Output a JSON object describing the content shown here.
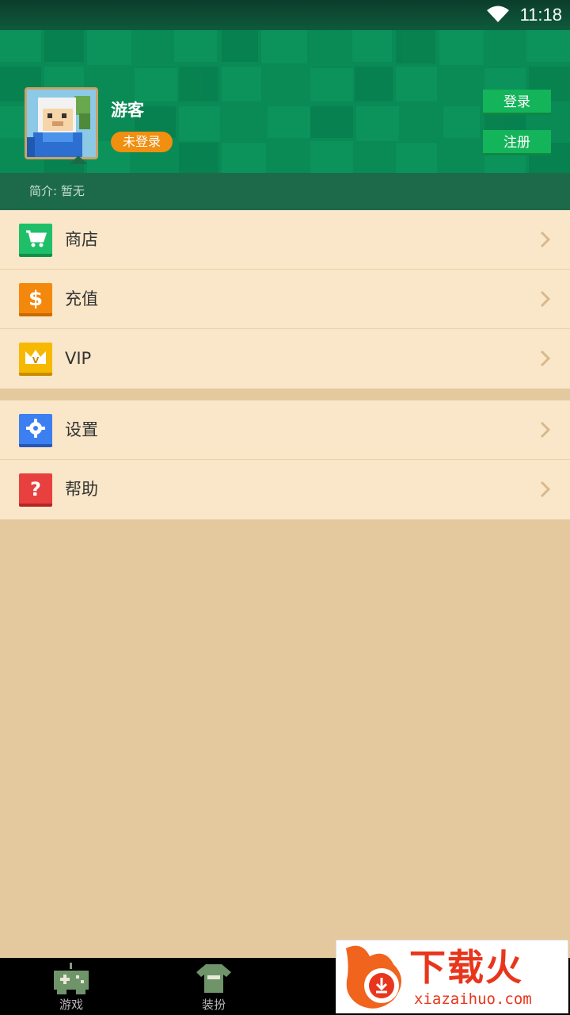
{
  "status_bar": {
    "time": "11:18",
    "wifi_icon": "wifi-icon"
  },
  "profile": {
    "name": "游客",
    "login_status": "未登录",
    "login_button": "登录",
    "register_button": "注册",
    "bio": "简介: 暂无",
    "avatar_icon": "avatar-blocky-character"
  },
  "menu_group_1": [
    {
      "label": "商店",
      "icon": "cart-icon",
      "color": "#1fbf6a"
    },
    {
      "label": "充值",
      "icon": "dollar-icon",
      "color": "#f4880c"
    },
    {
      "label": "VIP",
      "icon": "crown-icon",
      "color": "#f7b900"
    }
  ],
  "menu_group_2": [
    {
      "label": "设置",
      "icon": "gear-icon",
      "color": "#3b7ff0"
    },
    {
      "label": "帮助",
      "icon": "question-icon",
      "color": "#e8403f"
    }
  ],
  "bottom_nav": [
    {
      "label": "游戏",
      "icon": "gamepad-icon"
    },
    {
      "label": "装扮",
      "icon": "shirt-icon"
    }
  ],
  "watermark": {
    "title": "下载火",
    "url": "xiazaihuo.com"
  },
  "colors": {
    "header_green": "#0a8a55",
    "bio_bar": "#1d6a4a",
    "menu_bg": "#fae6c8",
    "page_bg": "#e4c99e",
    "badge_orange": "#f08f10",
    "button_green": "#14b45a"
  }
}
